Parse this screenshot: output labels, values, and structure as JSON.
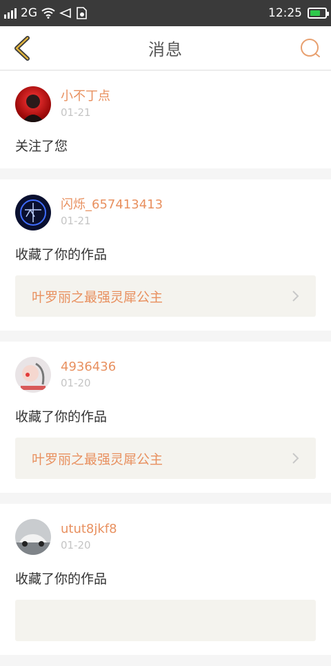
{
  "status_bar": {
    "network": "2G",
    "time": "12:25"
  },
  "header": {
    "title": "消息",
    "icons": {
      "back": "chevron-left-icon",
      "search": "search-icon"
    }
  },
  "colors": {
    "accent": "#e8905f",
    "nav_icon": "#e0b33c",
    "card_link_bg": "#f4f3ee",
    "battery": "#2ec84b"
  },
  "messages": [
    {
      "username": "小不丁点",
      "date": "01-21",
      "action": "关注了您",
      "work": null
    },
    {
      "username": "闪烁_657413413",
      "date": "01-21",
      "action": "收藏了你的作品",
      "work": "叶罗丽之最强灵犀公主"
    },
    {
      "username": "4936436",
      "date": "01-20",
      "action": "收藏了你的作品",
      "work": "叶罗丽之最强灵犀公主"
    },
    {
      "username": "utut8jkf8",
      "date": "01-20",
      "action": "收藏了你的作品",
      "work": ""
    }
  ]
}
